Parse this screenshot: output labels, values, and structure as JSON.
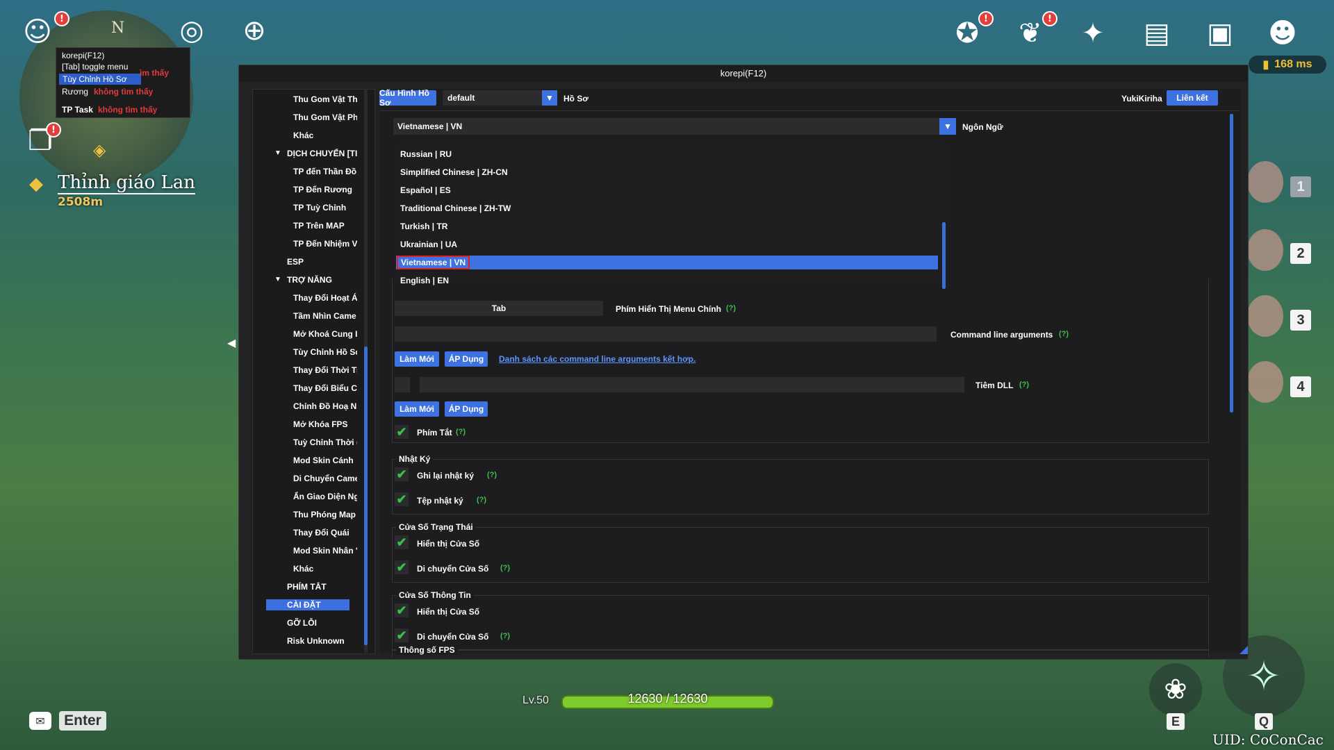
{
  "hud": {
    "compass_letter": "N",
    "small_popup": {
      "title": "korepi(F12)",
      "toggle": "[Tab] toggle menu",
      "selected": "Tùy Chỉnh Hồ Sơ",
      "row1_label": "Rương",
      "row1_status": "không tìm thấy",
      "row2_label": "TP Task",
      "row2_status": "không tìm thấy",
      "peek_status": "ìm thấy"
    },
    "quest": {
      "name": "Thỉnh giáo Lan",
      "distance": "2508m"
    },
    "ping": "168 ms",
    "party_numbers": [
      "1",
      "2",
      "3",
      "4"
    ],
    "level": "Lv.50",
    "hp": "12630 / 12630",
    "hp_fraction": 1.0,
    "enter_key": "Enter",
    "skill_e": "E",
    "skill_q": "Q",
    "uid": "UID: CoConCac",
    "notifications": [
      "!",
      "!",
      "!",
      "!"
    ]
  },
  "window": {
    "title": "korepi(F12)",
    "sidebar": {
      "items": [
        {
          "label": "Thu Gom Vật Th",
          "indent": 2
        },
        {
          "label": "Thu Gom Vật Ph",
          "indent": 2
        },
        {
          "label": "Khác",
          "indent": 2
        },
        {
          "label": "DỊCH CHUYỂN [TI",
          "indent": 1,
          "expand": "▼"
        },
        {
          "label": "TP đến Thần Đồ",
          "indent": 2
        },
        {
          "label": "TP Đến Rương",
          "indent": 2
        },
        {
          "label": "TP Tuỳ Chỉnh",
          "indent": 2
        },
        {
          "label": "TP Trên MAP",
          "indent": 2
        },
        {
          "label": "TP Đến Nhiệm V",
          "indent": 2
        },
        {
          "label": "ESP",
          "indent": 1
        },
        {
          "label": "TRỢ NĂNG",
          "indent": 1,
          "expand": "▼"
        },
        {
          "label": "Thay Đổi Hoạt Á",
          "indent": 2
        },
        {
          "label": "Tầm Nhìn Came",
          "indent": 2
        },
        {
          "label": "Mở Khoá Cung I",
          "indent": 2
        },
        {
          "label": "Tùy Chỉnh Hồ Sơ",
          "indent": 2
        },
        {
          "label": "Thay Đổi Thời Ti",
          "indent": 2
        },
        {
          "label": "Thay Đổi Biểu C",
          "indent": 2
        },
        {
          "label": "Chỉnh Đồ Hoạ N",
          "indent": 2
        },
        {
          "label": "Mở Khóa FPS",
          "indent": 2
        },
        {
          "label": "Tuỳ Chỉnh Thời (",
          "indent": 2
        },
        {
          "label": "Mod Skin Cánh",
          "indent": 2
        },
        {
          "label": "Di Chuyển Came",
          "indent": 2
        },
        {
          "label": "Ẩn Giao Diện Ng",
          "indent": 2
        },
        {
          "label": "Thu Phóng Map",
          "indent": 2
        },
        {
          "label": "Thay Đổi Quái",
          "indent": 2
        },
        {
          "label": "Mod Skin Nhân '",
          "indent": 2
        },
        {
          "label": "Khác",
          "indent": 2
        },
        {
          "label": "PHÍM TẮT",
          "indent": 1
        },
        {
          "label": "CÀI ĐẶT",
          "indent": 1,
          "selected": true
        },
        {
          "label": "GỠ LỖI",
          "indent": 1
        },
        {
          "label": "Risk Unknown",
          "indent": 1
        }
      ]
    },
    "profile": {
      "config_button": "Cấu Hình Hồ Sơ",
      "profile_value": "default",
      "profile_label": "Hồ Sơ",
      "user_name": "YukiKiriha",
      "link_button": "Liên kết"
    },
    "language": {
      "selected_value": "Vietnamese | VN",
      "label": "Ngôn Ngữ",
      "options": [
        "Russian | RU",
        "Simplified Chinese | ZH-CN",
        "Español | ES",
        "Traditional Chinese | ZH-TW",
        "Turkish | TR",
        "Ukrainian | UA",
        "Vietnamese | VN",
        "English | EN"
      ],
      "highlighted_option": "Vietnamese | VN"
    },
    "hotkey": {
      "value": "Tab",
      "label": "Phím Hiển Thị Menu Chính",
      "help": "(?)"
    },
    "cmdline": {
      "label": "Command line arguments",
      "help": "(?)",
      "reset_button": "Làm Mới",
      "apply_button": "ÁP Dụng",
      "link": "Danh sách các command line arguments kết hợp."
    },
    "dll": {
      "label": "Tiêm DLL",
      "help": "(?)",
      "reset_button": "Làm Mới",
      "apply_button": "ÁP Dụng"
    },
    "hotkeys_check": {
      "label": "Phím Tắt",
      "help": "(?)",
      "checked": true
    },
    "log_group": {
      "title": "Nhật Ký",
      "items": [
        {
          "label": "Ghi lại nhật ký",
          "help": "(?)",
          "checked": true
        },
        {
          "label": "Tệp nhật ký",
          "help": "(?)",
          "checked": true
        }
      ]
    },
    "status_group": {
      "title": "Cửa Số Trạng Thái",
      "items": [
        {
          "label": "Hiển thị Cửa Số",
          "help": "",
          "checked": true
        },
        {
          "label": "Di chuyển Cửa Số",
          "help": "(?)",
          "checked": true
        }
      ]
    },
    "info_group": {
      "title": "Cửa Số Thông Tin",
      "items": [
        {
          "label": "Hiển thị Cửa Số",
          "help": "",
          "checked": true
        },
        {
          "label": "Di chuyển Cửa Số",
          "help": "(?)",
          "checked": true
        }
      ]
    },
    "fps_group": {
      "title": "Thông số FPS"
    },
    "colors": {
      "accent": "#3d72e0",
      "help": "#3fbf4a",
      "highlight_border": "#e02020"
    }
  }
}
